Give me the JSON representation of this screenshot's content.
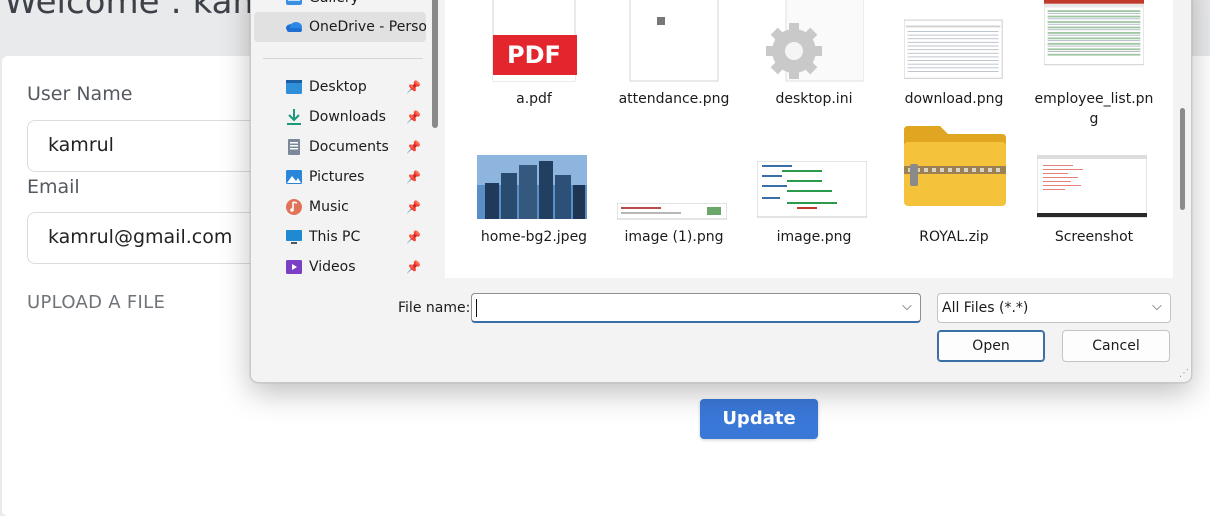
{
  "page": {
    "welcome": "Welcome : kamrul",
    "username_label": "User Name",
    "username_value": "kamrul",
    "email_label": "Email",
    "email_value": "kamrul@gmail.com",
    "upload_label": "UPLOAD A FILE",
    "update_button": "Update"
  },
  "dialog": {
    "nav_items": [
      {
        "label": "Gallery",
        "icon": "gallery-icon"
      },
      {
        "label": "OneDrive - Personal",
        "icon": "onedrive-icon",
        "selected": true
      },
      {
        "label": "Desktop",
        "icon": "desktop-icon",
        "pinned": true
      },
      {
        "label": "Downloads",
        "icon": "downloads-icon",
        "pinned": true
      },
      {
        "label": "Documents",
        "icon": "documents-icon",
        "pinned": true
      },
      {
        "label": "Pictures",
        "icon": "pictures-icon",
        "pinned": true
      },
      {
        "label": "Music",
        "icon": "music-icon",
        "pinned": true
      },
      {
        "label": "This PC",
        "icon": "this-pc-icon",
        "pinned": true
      },
      {
        "label": "Videos",
        "icon": "videos-icon",
        "pinned": true
      }
    ],
    "pdf_badge": "PDF",
    "files": [
      {
        "name": "a.pdf",
        "icon": "pdf-icon"
      },
      {
        "name": "attendance.png",
        "icon": "image-file-icon"
      },
      {
        "name": "desktop.ini",
        "icon": "settings-file-icon"
      },
      {
        "name": "download.png",
        "icon": "image-file-icon"
      },
      {
        "name": "employee_list.png",
        "icon": "image-file-icon"
      },
      {
        "name": "home-bg2.jpeg",
        "icon": "image-file-icon"
      },
      {
        "name": "image (1).png",
        "icon": "image-file-icon"
      },
      {
        "name": "image.png",
        "icon": "image-file-icon"
      },
      {
        "name": "ROYAL.zip",
        "icon": "zip-folder-icon"
      },
      {
        "name": "Screenshot",
        "icon": "image-file-icon"
      }
    ],
    "file_name_label": "File name:",
    "file_name_value": "",
    "filter_value": "All Files (*.*)",
    "open_button": "Open",
    "cancel_button": "Cancel",
    "pin_glyph": "📌"
  },
  "colors": {
    "accent": "#3a78d8",
    "dialog_bg": "#f3f3f3",
    "focus_border": "#3a6ea5"
  }
}
